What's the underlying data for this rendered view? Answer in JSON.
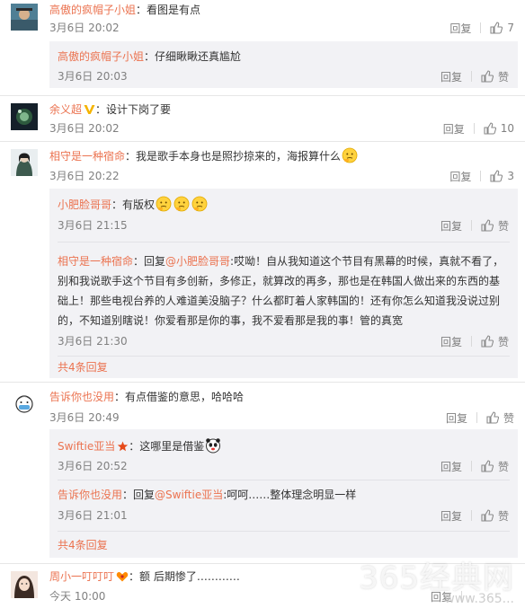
{
  "comments": [
    {
      "user": "高傲的疯帽子小姐",
      "text": "：看图是有点",
      "time": "3月6日 20:02",
      "reply_label": "回复",
      "like_count": "7",
      "replies": [
        {
          "user": "高傲的疯帽子小姐",
          "text": "：仔细瞅瞅还真尴尬",
          "time": "3月6日 20:03",
          "reply_label": "回复",
          "like_label": "赞"
        }
      ]
    },
    {
      "user": "余义超",
      "text": "：设计下岗了要",
      "time": "3月6日 20:02",
      "reply_label": "回复",
      "like_count": "10"
    },
    {
      "user": "相守是一种宿命",
      "text": "：我是歌手本身也是照抄掠来的，海报算什么",
      "time": "3月6日 20:22",
      "reply_label": "回复",
      "like_count": "3",
      "replies": [
        {
          "user": "小肥脸哥哥",
          "text": "：有版权",
          "time": "3月6日 21:15",
          "reply_label": "回复",
          "like_label": "赞"
        },
        {
          "user": "相守是一种宿命",
          "prefix": "：回复",
          "mention": "@小肥脸哥哥",
          "text": ":哎呦！自从我知道这个节目有黑幕的时候，真就不看了，别和我说歌手这个节目有多创新，多修正，就算改的再多，那也是在韩国人做出来的东西的基础上！那些电视台养的人难道美没脑子？什么都盯着人家韩国的！还有你怎么知道我没说过别的，不知道别瞎说！你爱看那是你的事，我不爱看那是我的事！管的真宽",
          "time": "3月6日 21:30",
          "reply_label": "回复",
          "like_label": "赞"
        }
      ],
      "more": "共4条回复"
    },
    {
      "user": "告诉你也没用",
      "text": "：有点借鉴的意思，哈哈哈",
      "time": "3月6日 20:49",
      "reply_label": "回复",
      "like_label": "赞",
      "replies": [
        {
          "user": "Swiftie亚当",
          "text": "：这哪里是借鉴",
          "time": "3月6日 20:52",
          "reply_label": "回复",
          "like_label": "赞"
        },
        {
          "user": "告诉你也没用",
          "prefix": "：回复",
          "mention": "@Swiftie亚当",
          "text": ":呵呵……整体理念明显一样",
          "time": "3月6日 21:01",
          "reply_label": "回复",
          "like_label": "赞"
        }
      ],
      "more": "共4条回复"
    },
    {
      "user": "周小一叮叮叮",
      "text": "：额 后期惨了…………",
      "time": "今天 10:00",
      "reply_label": "回复"
    }
  ],
  "watermark": {
    "main": "365经典网",
    "sub": "www.365..."
  },
  "colors": {
    "username": "#eb7350",
    "meta": "#808080",
    "reply_bg": "#f2f2f5"
  },
  "icons": [
    "avatar",
    "thumbs-up-icon",
    "vip-v-badge",
    "star-badge",
    "emoji-thinking",
    "emoji-panda",
    "emoji-heart"
  ]
}
